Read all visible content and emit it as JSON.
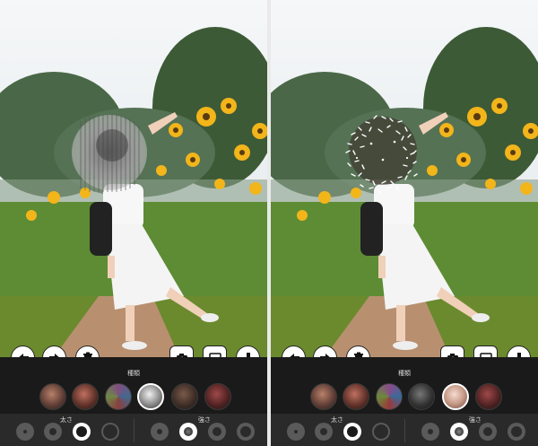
{
  "panels": [
    {
      "id": "left",
      "effect": "blur",
      "toolbar": {
        "undo_icon": "undo-icon",
        "redo_icon": "redo-icon",
        "trash_icon": "trash-icon",
        "camera_icon": "camera-icon",
        "album_icon": "album-icon",
        "download_icon": "download-icon"
      },
      "type_label": "種類",
      "swatches": [
        "swatch-1",
        "swatch-2",
        "swatch-3",
        "swatch-4",
        "swatch-5",
        "swatch-6"
      ],
      "selected_swatch": 3,
      "thickness_label": "太さ",
      "strength_label": "強さ",
      "selected_thickness": 2,
      "selected_strength": 1
    },
    {
      "id": "right",
      "effect": "glitter",
      "toolbar": {
        "undo_icon": "undo-icon",
        "redo_icon": "redo-icon",
        "trash_icon": "trash-icon",
        "camera_icon": "camera-icon",
        "album_icon": "album-icon",
        "download_icon": "download-icon"
      },
      "type_label": "種類",
      "swatches": [
        "swatch-1",
        "swatch-2",
        "swatch-3",
        "swatch-4",
        "swatch-5",
        "swatch-6"
      ],
      "selected_swatch": 4,
      "thickness_label": "太さ",
      "strength_label": "強さ",
      "selected_thickness": 2,
      "selected_strength": 1
    }
  ],
  "colors": {
    "sky": "#e8eef2",
    "tree": "#3d5a36",
    "grass": "#5d8c34",
    "sunflower": "#f2b51a",
    "dress": "#f4f4f4",
    "toolbar_bg": "#1a1a1a",
    "subbar_bg": "#2a2a2a"
  }
}
